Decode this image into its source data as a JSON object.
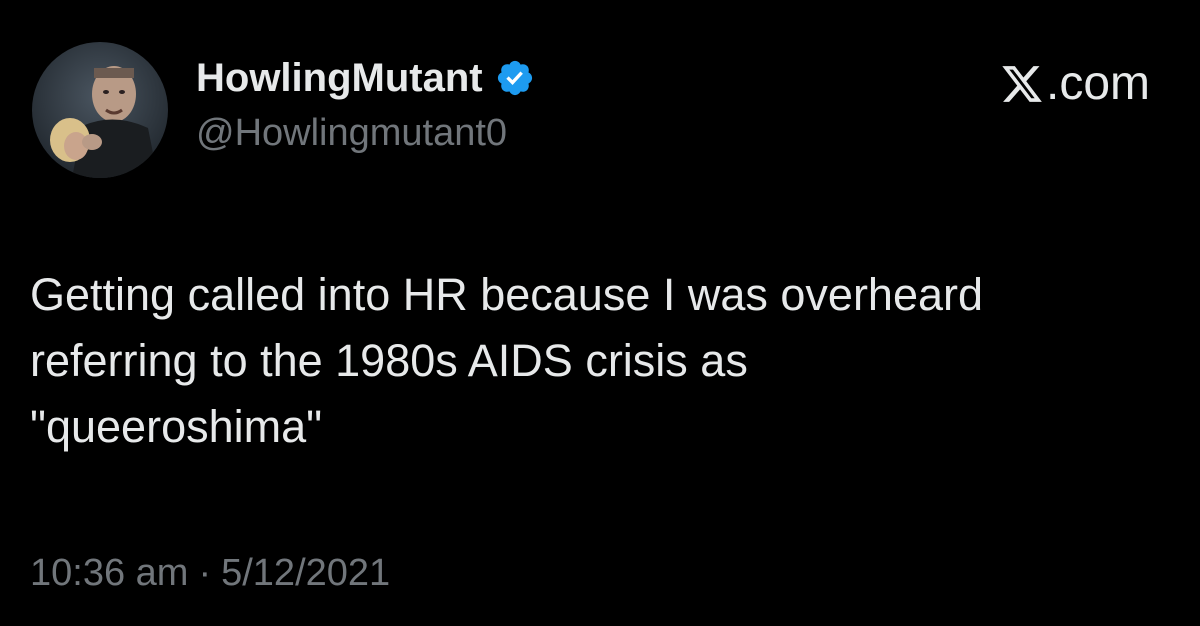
{
  "author": {
    "display_name": "HowlingMutant",
    "handle": "@Howlingmutant0",
    "verified": true,
    "avatar_icon": "profile-photo-avatar",
    "verified_icon": "verified-badge-icon",
    "verified_color": "#1d9bf0"
  },
  "brand": {
    "logo_icon": "x-logo-icon",
    "logo_letter": "X",
    "domain": ".com"
  },
  "tweet": {
    "lines": [
      "Getting called into HR because I was overheard",
      "referring to the 1980s AIDS crisis as",
      "\"queeroshima\""
    ]
  },
  "meta": {
    "time": "10:36 am",
    "separator": "·",
    "date": "5/12/2021"
  },
  "colors": {
    "background": "#000000",
    "primary_text": "#e7e9ea",
    "secondary_text": "#71767b"
  }
}
